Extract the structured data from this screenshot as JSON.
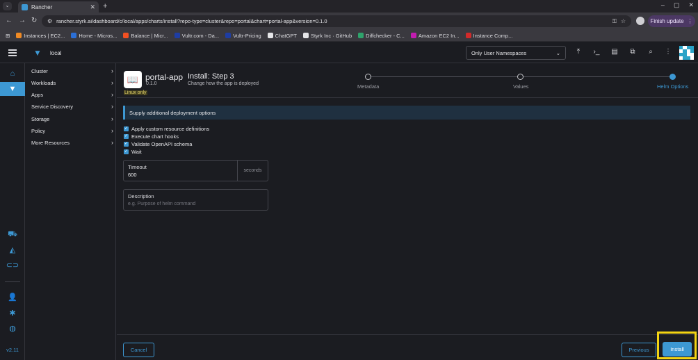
{
  "browser": {
    "tab_title": "Rancher",
    "new_tab": "+",
    "url": "rancher.styrk.ai/dashboard/c/local/apps/charts/install?repo-type=cluster&repo=portal&chart=portal-app&version=0.1.0",
    "finish_update": "Finish update",
    "bookmarks": [
      {
        "label": "Instances | EC2...",
        "color": "#f08a24"
      },
      {
        "label": "Home - Micros...",
        "color": "#2b6fd6"
      },
      {
        "label": "Balance | Micr...",
        "color": "#f25022"
      },
      {
        "label": "Vultr.com - Da...",
        "color": "#1e3da3"
      },
      {
        "label": "Vultr-Pricing",
        "color": "#1e3da3"
      },
      {
        "label": "ChatGPT",
        "color": "#e5e5e8"
      },
      {
        "label": "Styrk Inc · GitHub",
        "color": "#e5e5e8"
      },
      {
        "label": "Diffchecker - C...",
        "color": "#2ea36b"
      },
      {
        "label": "Amazon EC2 In...",
        "color": "#c21cb0"
      },
      {
        "label": "Instance Comp...",
        "color": "#d12a2a"
      }
    ]
  },
  "header": {
    "cluster_name": "local",
    "namespace_filter": "Only User Namespaces"
  },
  "rail": {
    "version": "v2.11"
  },
  "sidenav": {
    "items": [
      {
        "label": "Cluster"
      },
      {
        "label": "Workloads"
      },
      {
        "label": "Apps"
      },
      {
        "label": "Service Discovery"
      },
      {
        "label": "Storage"
      },
      {
        "label": "Policy"
      },
      {
        "label": "More Resources"
      }
    ]
  },
  "chart": {
    "name": "portal-app",
    "version": "0.1.0",
    "os_badge": "Linux only"
  },
  "step": {
    "title": "Install: Step 3",
    "subtitle": "Change how the app is deployed",
    "steps": [
      {
        "label": "Metadata",
        "active": false
      },
      {
        "label": "Values",
        "active": false
      },
      {
        "label": "Helm Options",
        "active": true
      }
    ]
  },
  "options": {
    "banner": "Supply additional deployment options",
    "checkboxes": [
      {
        "label": "Apply custom resource definitions",
        "checked": true
      },
      {
        "label": "Execute chart hooks",
        "checked": true
      },
      {
        "label": "Validate OpenAPI schema",
        "checked": true
      },
      {
        "label": "Wait",
        "checked": true
      }
    ],
    "timeout": {
      "label": "Timeout",
      "value": "600",
      "suffix": "seconds"
    },
    "description": {
      "label": "Description",
      "placeholder": "e.g. Purpose of helm command"
    }
  },
  "footer": {
    "cancel": "Cancel",
    "previous": "Previous",
    "install": "Install"
  },
  "colors": {
    "accent": "#3d98d3",
    "highlight": "#f3d313"
  }
}
